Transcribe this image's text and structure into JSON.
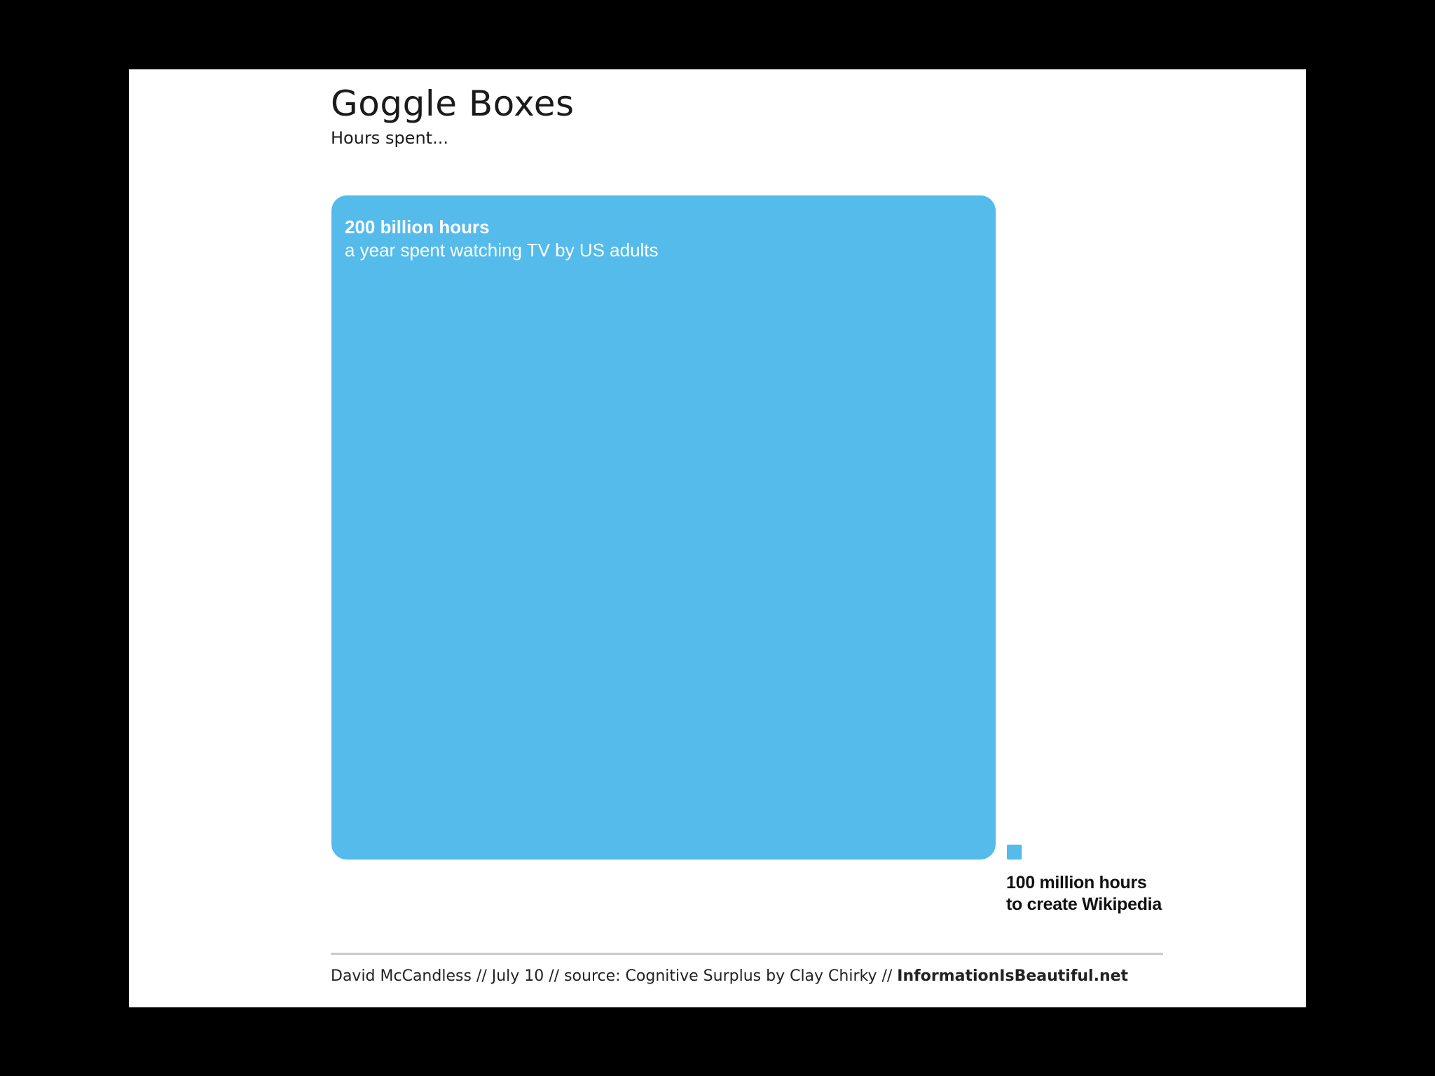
{
  "header": {
    "title": "Goggle Boxes",
    "subtitle": "Hours spent..."
  },
  "chart_data": {
    "type": "area-comparison",
    "unit": "hours",
    "series": [
      {
        "value": 200000000000,
        "value_label": "200 billion hours",
        "description": "a year spent watching TV by US adults"
      },
      {
        "value": 100000000,
        "value_label": "100 million hours",
        "description": "to create Wikipedia"
      }
    ],
    "color": "#54bbeb"
  },
  "footer": {
    "credit": "David McCandless // July 10 // source: Cognitive Surplus by Clay Chirky // ",
    "site": "InformationIsBeautiful.net"
  }
}
